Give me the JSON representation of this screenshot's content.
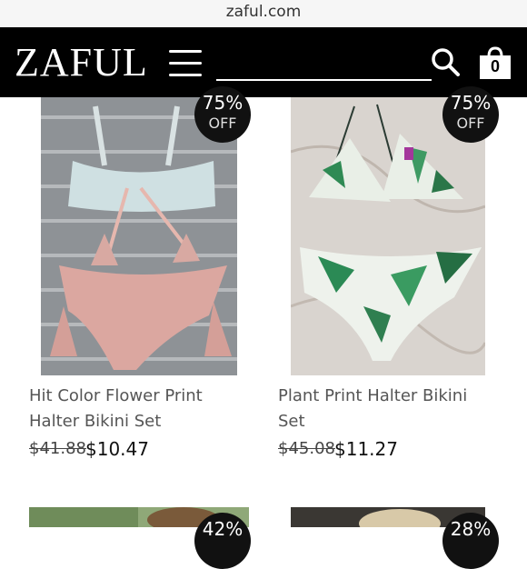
{
  "browser": {
    "url": "zaful.com"
  },
  "header": {
    "logo": "ZAFUL",
    "cart_count": "0"
  },
  "products": [
    {
      "discount": "75%",
      "off_label": "OFF",
      "title_line1": "Hit Color Flower Print",
      "title_line2": "Halter Bikini Set",
      "old_price": "$41.88",
      "price": "$10.47"
    },
    {
      "discount": "75%",
      "off_label": "OFF",
      "title_line1": "Plant Print Halter Bikini",
      "title_line2": "Set",
      "old_price": "$45.08",
      "price": "$11.27"
    },
    {
      "discount": "42%"
    },
    {
      "discount": "28%"
    }
  ]
}
